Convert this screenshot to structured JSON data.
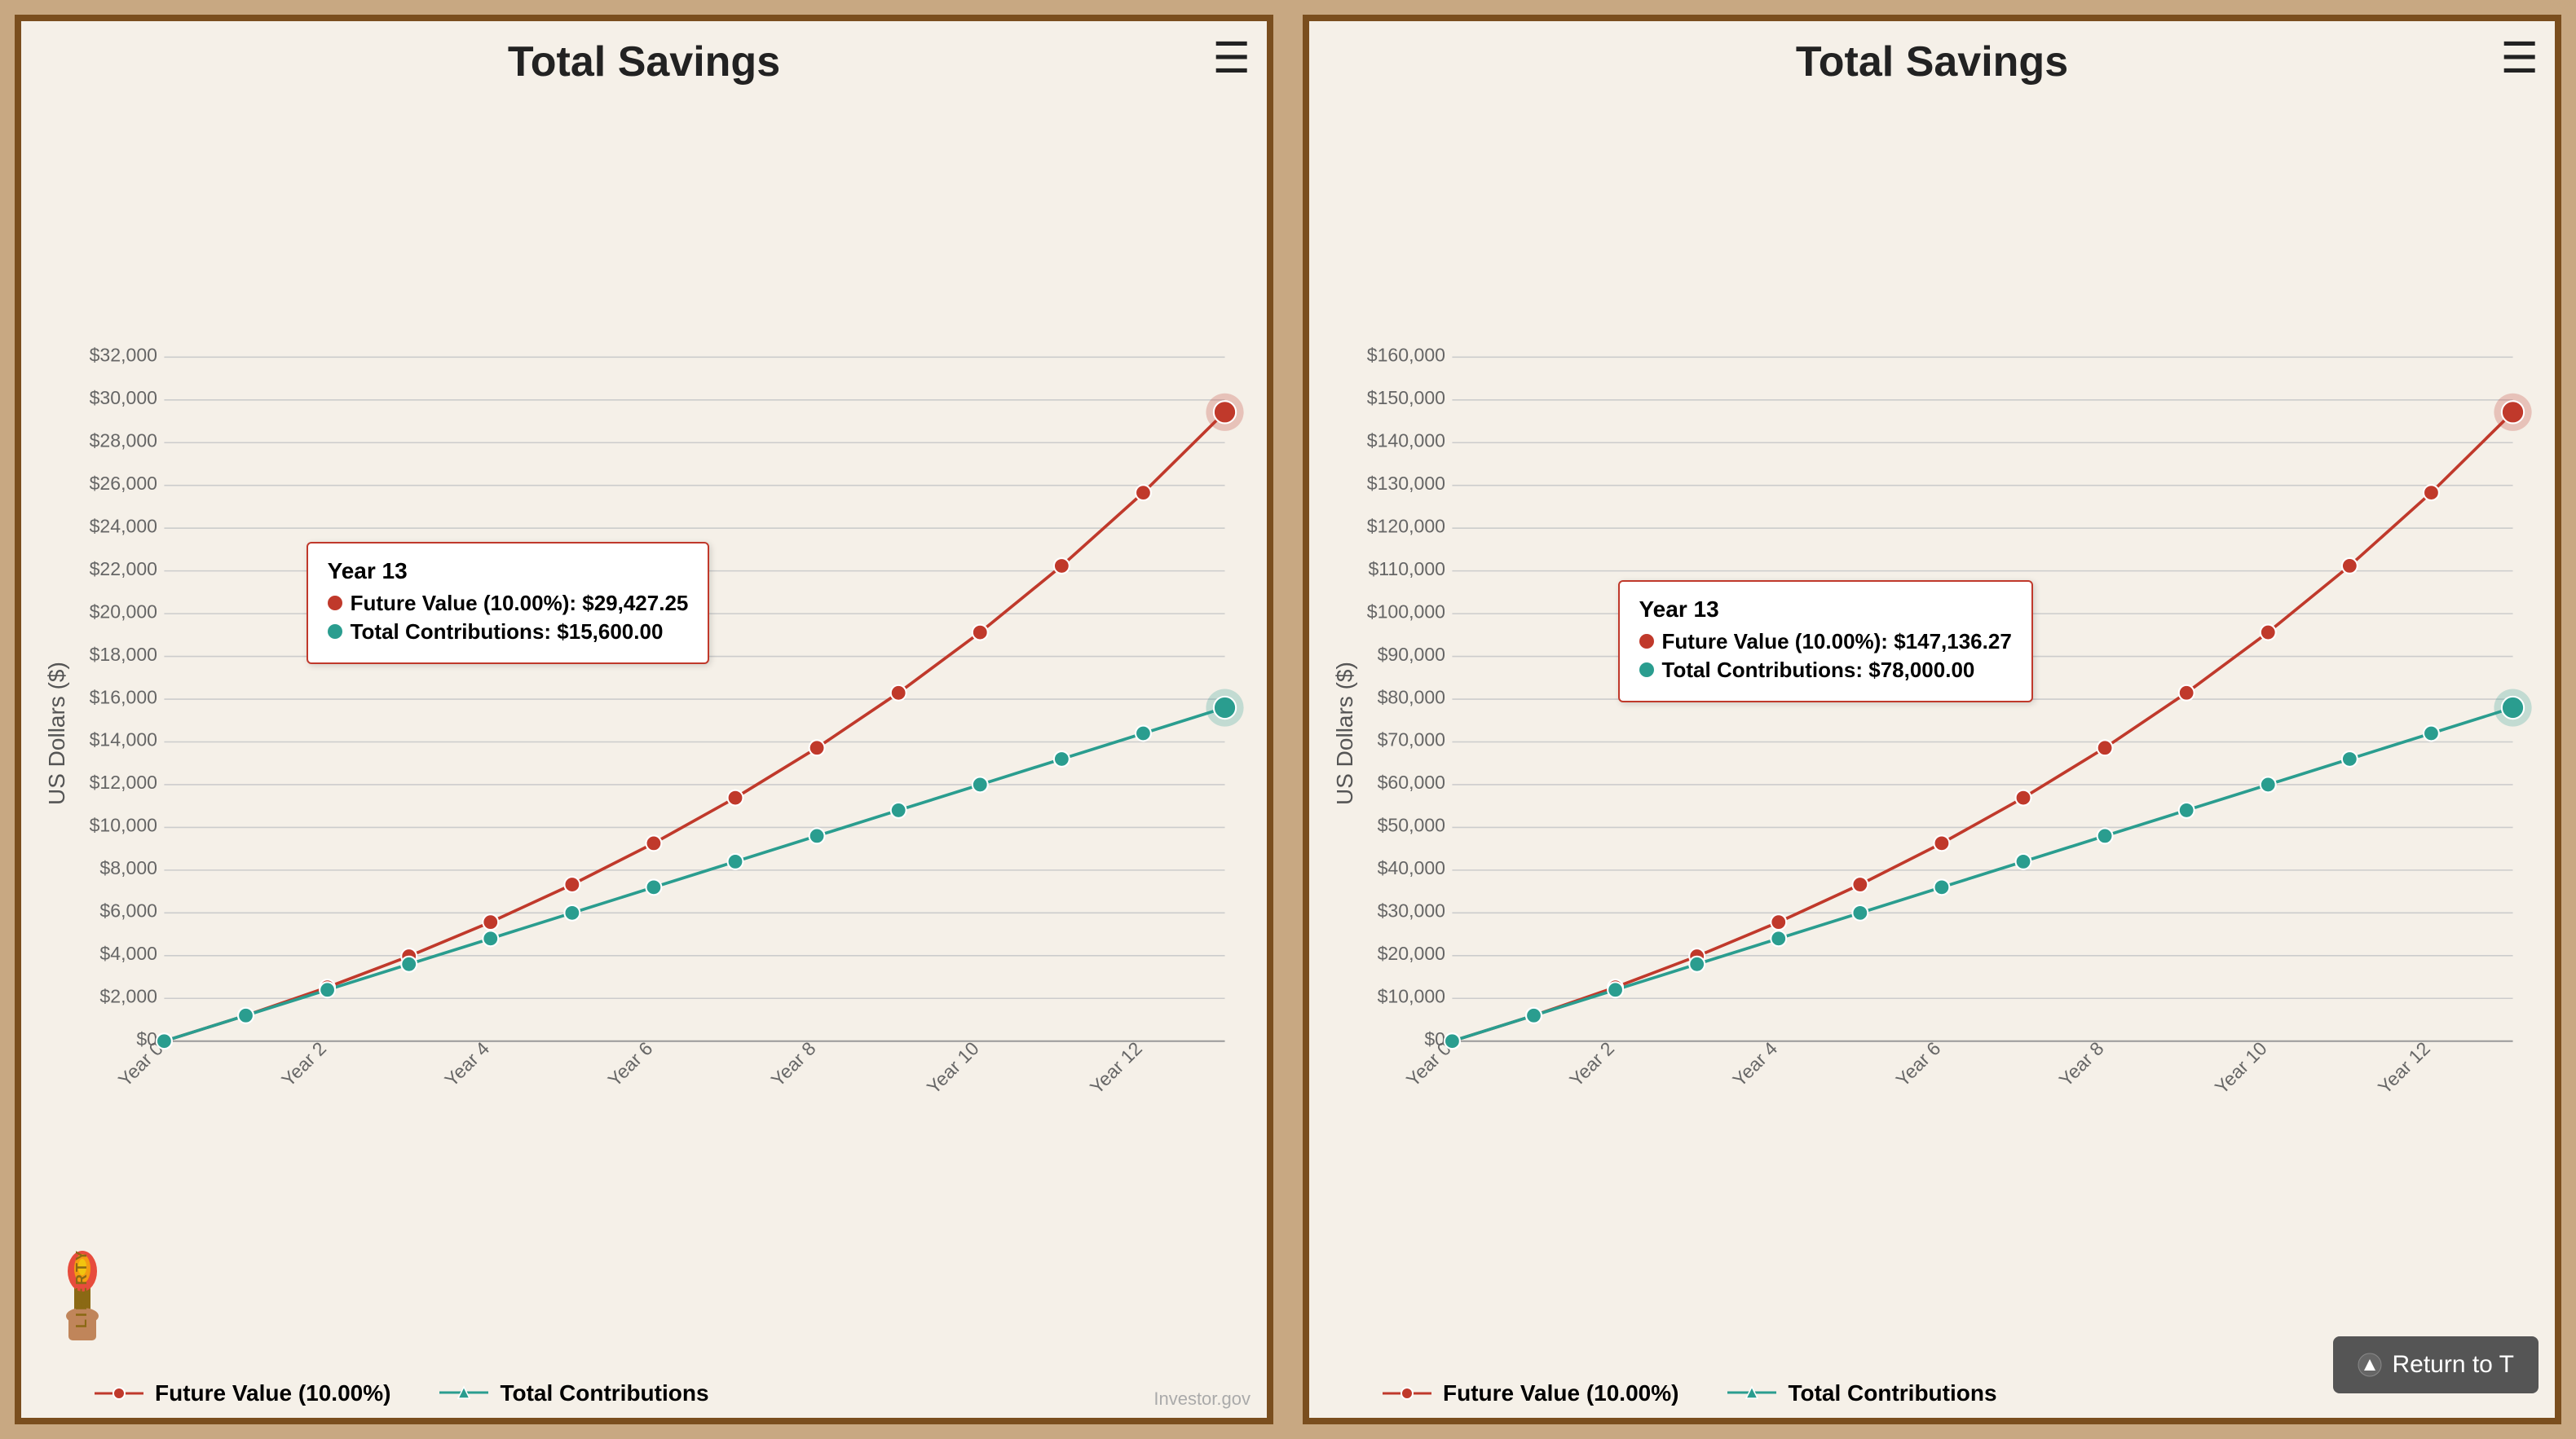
{
  "charts": [
    {
      "id": "chart-left",
      "title": "Total Savings",
      "y_axis_label": "US Dollars ($)",
      "y_ticks": [
        "$0",
        "$2,000",
        "$4,000",
        "$6,000",
        "$8,000",
        "$10,000",
        "$12,000",
        "$14,000",
        "$16,000",
        "$18,000",
        "$20,000",
        "$22,000",
        "$24,000",
        "$26,000",
        "$28,000",
        "$30,000",
        "$32,000"
      ],
      "x_ticks": [
        "Year 0",
        "Year 2",
        "Year 4",
        "Year 6",
        "Year 8",
        "Year 10",
        "Year 12"
      ],
      "tooltip": {
        "title": "Year 13",
        "future_value_label": "Future Value (10.00%): $29,427.25",
        "contributions_label": "Total Contributions: $15,600.00"
      },
      "legend": {
        "future_value": "Future Value (10.00%)",
        "contributions": "Total Contributions"
      },
      "future_value_data": [
        0,
        1200,
        2520,
        3972,
        5569,
        7326,
        9258,
        11384,
        13722,
        16294,
        19123,
        22235,
        25659,
        29427
      ],
      "contributions_data": [
        0,
        1200,
        2400,
        3600,
        4800,
        6000,
        7200,
        8400,
        9600,
        10800,
        12000,
        13200,
        14400,
        15600
      ],
      "max_value": 32000,
      "show_liberty": true,
      "show_investor": true,
      "show_return": false
    },
    {
      "id": "chart-right",
      "title": "Total Savings",
      "y_axis_label": "US Dollars ($)",
      "y_ticks": [
        "$0",
        "$10,000",
        "$20,000",
        "$30,000",
        "$40,000",
        "$50,000",
        "$60,000",
        "$70,000",
        "$80,000",
        "$90,000",
        "$100,000",
        "$110,000",
        "$120,000",
        "$130,000",
        "$140,000",
        "$150,000",
        "$160,000"
      ],
      "x_ticks": [
        "Year 0",
        "Year 2",
        "Year 4",
        "Year 6",
        "Year 8",
        "Year 10",
        "Year 12"
      ],
      "tooltip": {
        "title": "Year 13",
        "future_value_label": "Future Value (10.00%): $147,136.27",
        "contributions_label": "Total Contributions: $78,000.00"
      },
      "legend": {
        "future_value": "Future Value (10.00%)",
        "contributions": "Total Contributions"
      },
      "future_value_data": [
        0,
        6000,
        12600,
        19860,
        27846,
        36631,
        46294,
        56923,
        68615,
        81477,
        95625,
        111187,
        128306,
        147136
      ],
      "contributions_data": [
        0,
        6000,
        12000,
        18000,
        24000,
        30000,
        36000,
        42000,
        48000,
        54000,
        60000,
        66000,
        72000,
        78000
      ],
      "max_value": 160000,
      "show_liberty": false,
      "show_investor": false,
      "show_return": true
    }
  ],
  "hamburger_label": "≡",
  "return_to_label": "Return to T",
  "investor_label": "Investor.gov"
}
